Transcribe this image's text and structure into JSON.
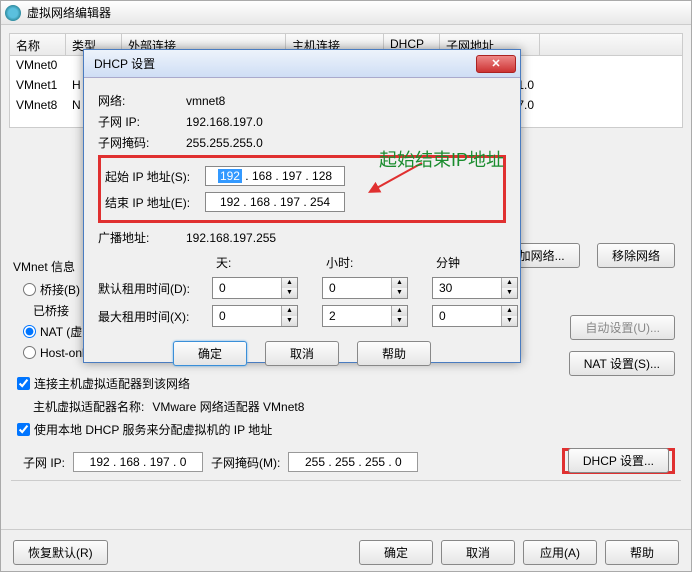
{
  "main": {
    "title": "虚拟网络编辑器",
    "columns": [
      "名称",
      "类型",
      "外部连接",
      "主机连接",
      "DHCP",
      "子网地址"
    ],
    "rows": [
      {
        "name": "VMnet0",
        "type": "",
        "ext": "",
        "host": "",
        "dhcp": "",
        "subnet": ""
      },
      {
        "name": "VMnet1",
        "type": "H",
        "ext": "",
        "host": "",
        "dhcp": "",
        "subnet": "1.0"
      },
      {
        "name": "VMnet8",
        "type": "N",
        "ext": "",
        "host": "",
        "dhcp": "",
        "subnet": "7.0"
      }
    ],
    "buttons": {
      "add_network": "加网络...",
      "remove_network": "移除网络",
      "auto_settings": "自动设置(U)...",
      "nat_settings": "NAT 设置(S)...",
      "dhcp_settings": "DHCP 设置...",
      "restore": "恢复默认(R)",
      "ok": "确定",
      "cancel": "取消",
      "apply": "应用(A)",
      "help": "帮助"
    },
    "info": {
      "header": "VMnet 信息",
      "bridged": "桥接(B)",
      "bridged_adapter": "已桥接",
      "nat": "NAT (虚",
      "hostonly": "Host-only (连接虚拟机到一个私有网络)",
      "connect_host": "连接主机虚拟适配器到该网络",
      "host_adapter_label": "主机虚拟适配器名称:",
      "host_adapter_value": "VMware 网络适配器 VMnet8",
      "use_dhcp": "使用本地 DHCP 服务来分配虚拟机的 IP 地址",
      "subnet_ip_label": "子网 IP:",
      "subnet_ip": "192 . 168 . 197 .  0",
      "subnet_mask_label": "子网掩码(M):",
      "subnet_mask": "255 . 255 . 255 .  0"
    }
  },
  "dialog": {
    "title": "DHCP 设置",
    "network_label": "网络:",
    "network": "vmnet8",
    "subnet_label": "子网 IP:",
    "subnet": "192.168.197.0",
    "mask_label": "子网掩码:",
    "mask": "255.255.255.0",
    "start_label": "起始 IP 地址(S):",
    "start_sel": "192",
    "start_rest": " . 168 . 197 . 128",
    "end_label": "结束 IP 地址(E):",
    "end": "192 . 168 . 197 . 254",
    "broadcast_label": "广播地址:",
    "broadcast": "192.168.197.255",
    "time_headers": {
      "days": "天:",
      "hours": "小时:",
      "minutes": "分钟"
    },
    "default_lease_label": "默认租用时间(D):",
    "default_lease": {
      "days": "0",
      "hours": "0",
      "minutes": "30"
    },
    "max_lease_label": "最大租用时间(X):",
    "max_lease": {
      "days": "0",
      "hours": "2",
      "minutes": "0"
    },
    "buttons": {
      "ok": "确定",
      "cancel": "取消",
      "help": "帮助"
    }
  },
  "annotation": "起始结束IP地址"
}
